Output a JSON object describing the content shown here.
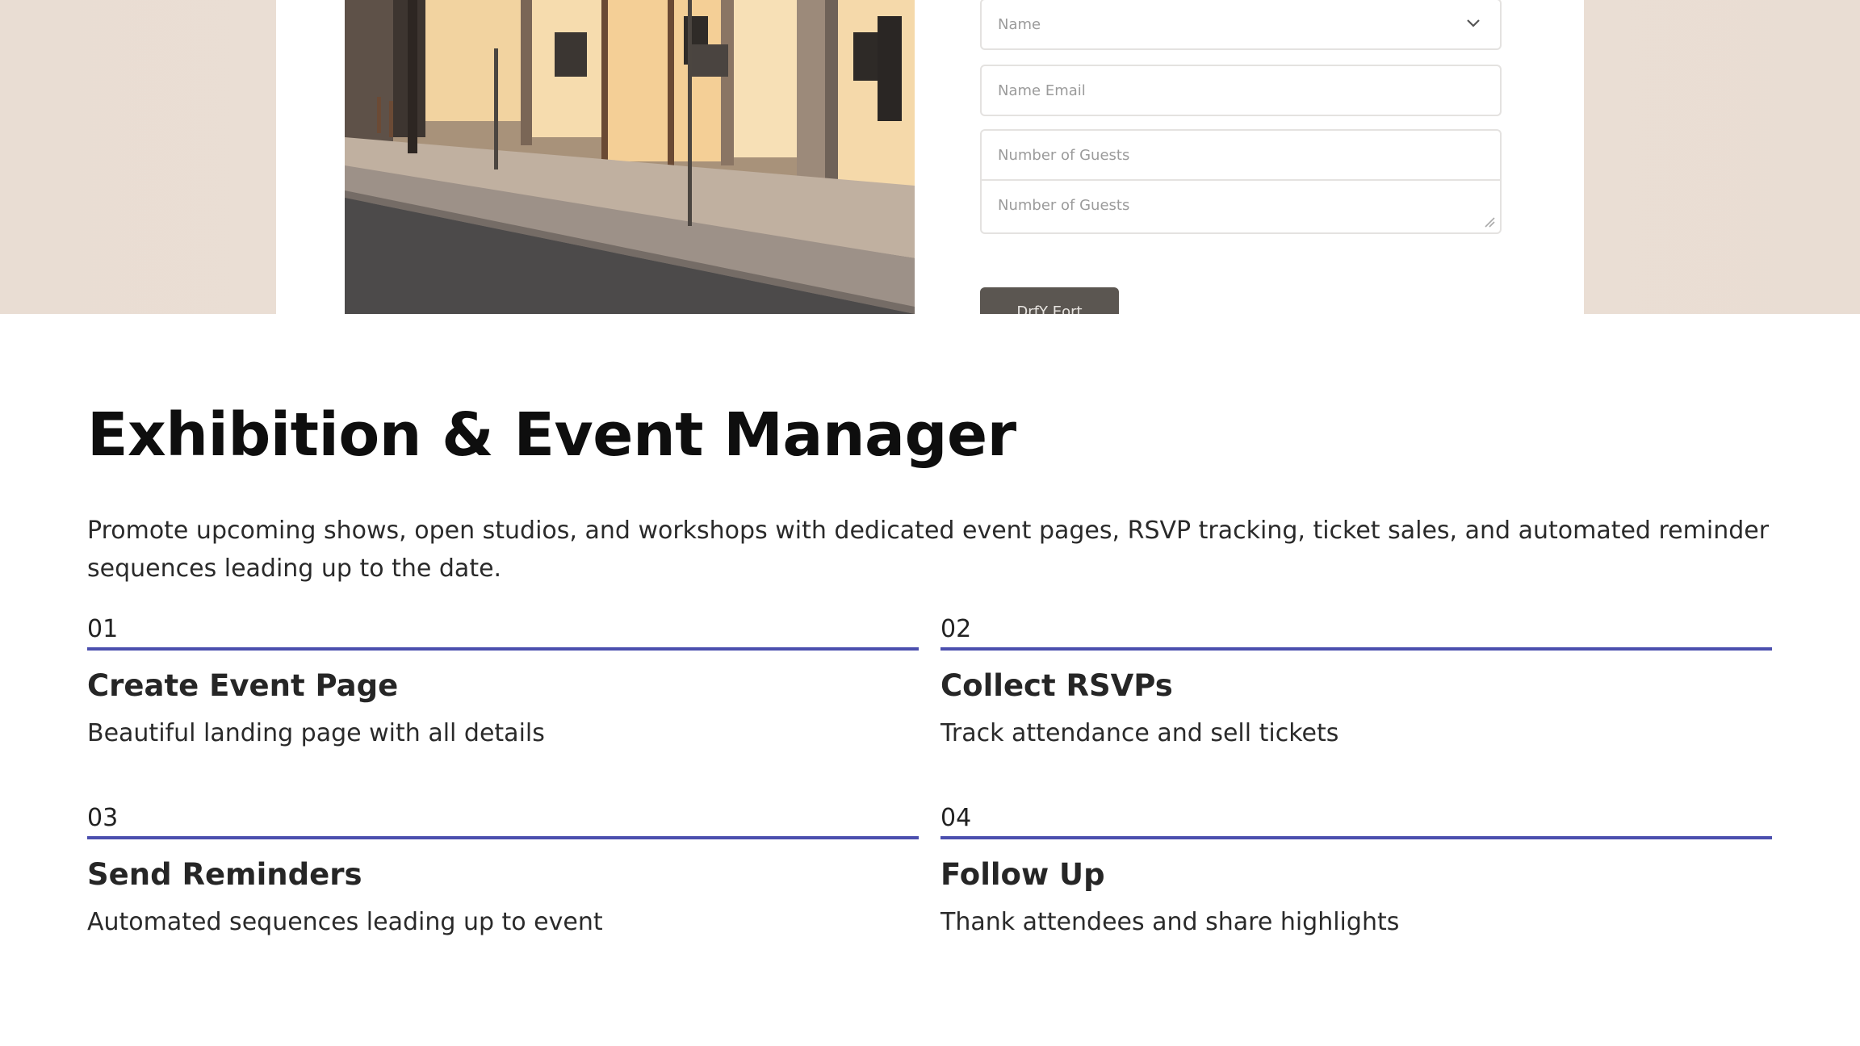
{
  "form": {
    "select_value": "Name",
    "email_placeholder": "Name  Email",
    "guests_placeholder_a": "Number of Guests",
    "guests_placeholder_b": "Number of Guests",
    "submit_label": "DrfY Eort"
  },
  "main": {
    "title": "Exhibition & Event Manager",
    "description": "Promote upcoming shows, open studios, and workshops with dedicated event pages, RSVP tracking, ticket sales, and automated reminder sequences leading up to the date.",
    "steps": [
      {
        "num": "01",
        "title": "Create Event Page",
        "text": "Beautiful landing page with all details"
      },
      {
        "num": "02",
        "title": "Collect RSVPs",
        "text": "Track attendance and sell tickets"
      },
      {
        "num": "03",
        "title": "Send Reminders",
        "text": "Automated sequences leading up to event"
      },
      {
        "num": "04",
        "title": "Follow Up",
        "text": "Thank attendees and share highlights"
      }
    ]
  },
  "colors": {
    "accent": "#4b4fae",
    "hero_bg": "#ecdfd5",
    "button": "#5b5651"
  },
  "icons": {
    "select_chevron": "chevron-down-icon",
    "textarea_resize": "resize-handle-icon"
  }
}
